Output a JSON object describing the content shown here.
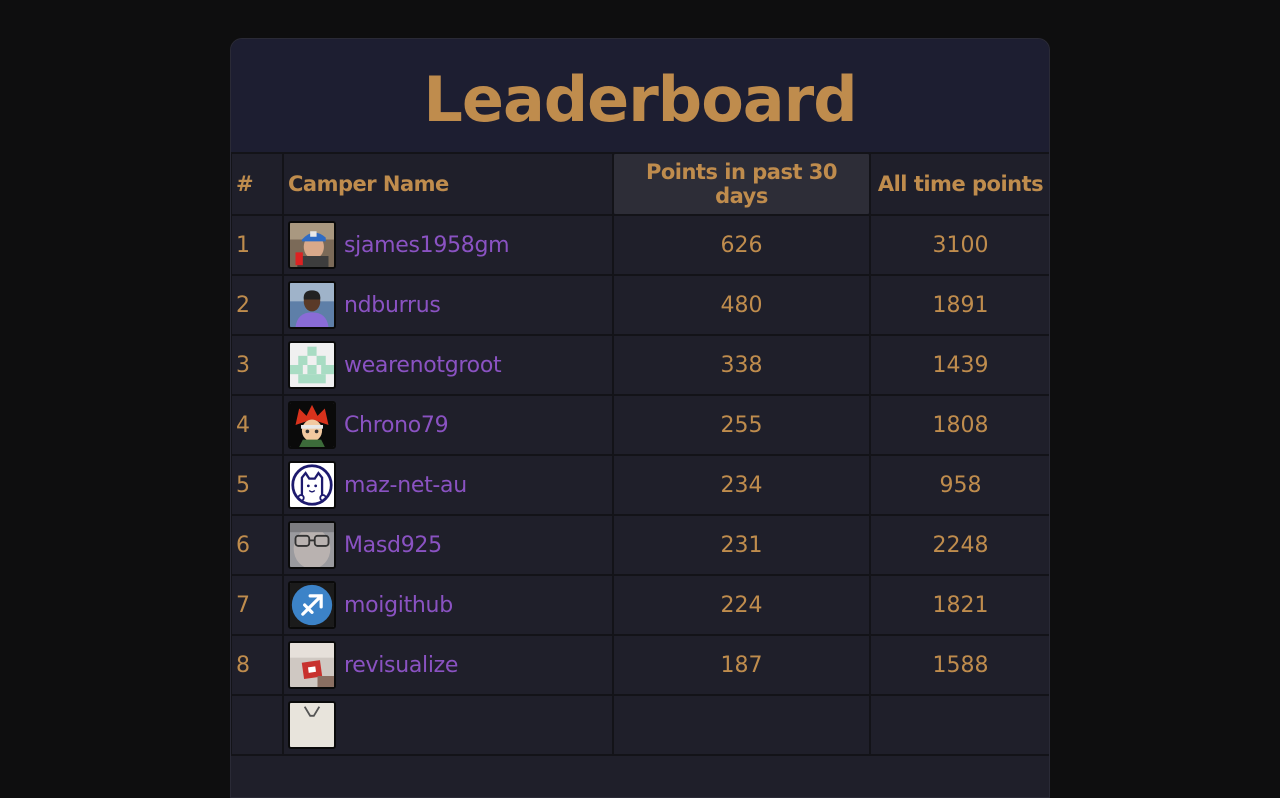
{
  "title": "Leaderboard",
  "columns": {
    "rank": "#",
    "name": "Camper Name",
    "recent": "Points in past 30 days",
    "alltime": "All time points"
  },
  "rows": [
    {
      "rank": "1",
      "name": "sjames1958gm",
      "recent": "626",
      "alltime": "3100",
      "avatar": "avatar-photo-man-cap-icon"
    },
    {
      "rank": "2",
      "name": "ndburrus",
      "recent": "480",
      "alltime": "1891",
      "avatar": "avatar-photo-man-icon"
    },
    {
      "rank": "3",
      "name": "wearenotgroot",
      "recent": "338",
      "alltime": "1439",
      "avatar": "avatar-identicon-icon"
    },
    {
      "rank": "4",
      "name": "Chrono79",
      "recent": "255",
      "alltime": "1808",
      "avatar": "avatar-anime-character-icon"
    },
    {
      "rank": "5",
      "name": "maz-net-au",
      "recent": "234",
      "alltime": "958",
      "avatar": "avatar-cat-drawing-icon"
    },
    {
      "rank": "6",
      "name": "Masd925",
      "recent": "231",
      "alltime": "2248",
      "avatar": "avatar-photo-glasses-icon"
    },
    {
      "rank": "7",
      "name": "moigithub",
      "recent": "224",
      "alltime": "1821",
      "avatar": "avatar-sagittarius-icon"
    },
    {
      "rank": "8",
      "name": "revisualize",
      "recent": "187",
      "alltime": "1588",
      "avatar": "avatar-photo-card-icon"
    },
    {
      "rank": "",
      "name": "",
      "recent": "",
      "alltime": "",
      "avatar": "avatar-partial-icon"
    }
  ],
  "colors": {
    "page_bg": "#0e0e0f",
    "panel_bg": "#1f1f2a",
    "header_bg": "#1d1e31",
    "accent_gold": "#bf8c4d",
    "link_purple": "#8a52c2",
    "sort_highlight": "#2d2d37"
  }
}
